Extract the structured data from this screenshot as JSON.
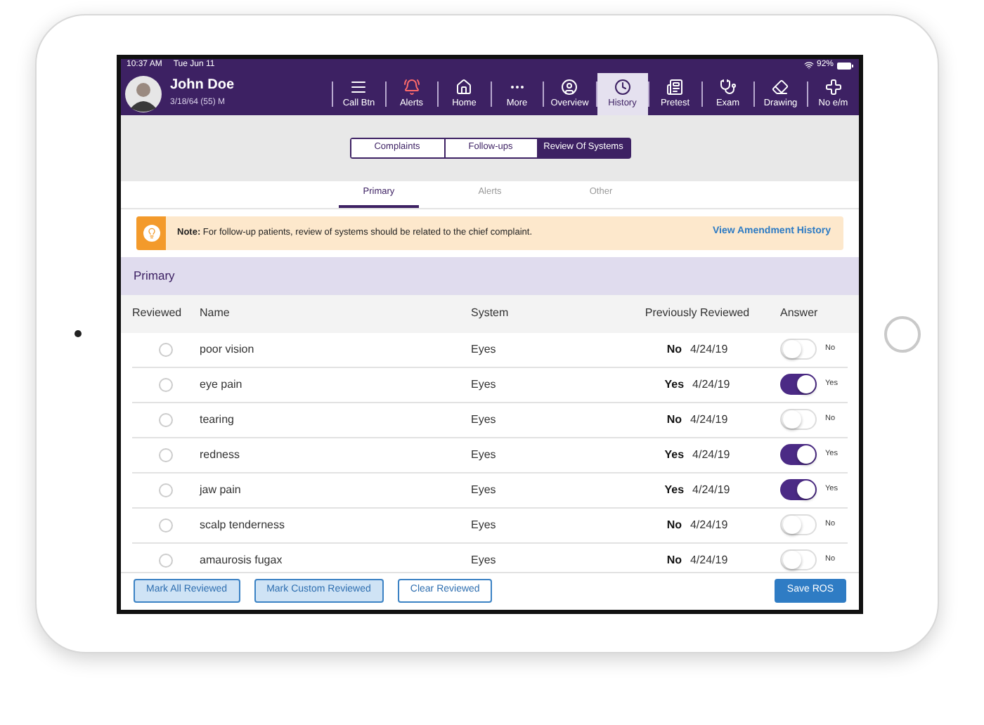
{
  "status_bar": {
    "time": "10:37 AM",
    "date": "Tue Jun 11",
    "battery": "92%"
  },
  "patient": {
    "name": "John Doe",
    "details": "3/18/64 (55) M"
  },
  "nav": [
    {
      "label": "Call Btn",
      "selected": false
    },
    {
      "label": "Alerts",
      "selected": false
    },
    {
      "label": "Home",
      "selected": false
    },
    {
      "label": "More",
      "selected": false
    },
    {
      "label": "Overview",
      "selected": false
    },
    {
      "label": "History",
      "selected": true
    },
    {
      "label": "Pretest",
      "selected": false
    },
    {
      "label": "Exam",
      "selected": false
    },
    {
      "label": "Drawing",
      "selected": false
    },
    {
      "label": "No e/m",
      "selected": false
    }
  ],
  "segments": [
    {
      "label": "Complaints",
      "selected": false
    },
    {
      "label": "Follow-ups",
      "selected": false
    },
    {
      "label": "Review Of Systems",
      "selected": true
    }
  ],
  "tabs": [
    {
      "label": "Primary",
      "selected": true
    },
    {
      "label": "Alerts",
      "selected": false
    },
    {
      "label": "Other",
      "selected": false
    }
  ],
  "note": {
    "text": "**Note:** For follow-up patients, review of systems should be related to the chief complaint.",
    "link": "View Amendment History"
  },
  "section_title": "Primary",
  "table": {
    "columns": [
      "Reviewed",
      "Name",
      "System",
      "Previously Reviewed",
      "Answer"
    ],
    "rows": [
      {
        "reviewed": false,
        "name": "poor vision",
        "system": "Eyes",
        "previous": "No",
        "date": "4/24/19",
        "answer": false,
        "answer_label": "No"
      },
      {
        "reviewed": false,
        "name": "eye pain",
        "system": "Eyes",
        "previous": "Yes",
        "date": "4/24/19",
        "answer": true,
        "answer_label": "Yes"
      },
      {
        "reviewed": false,
        "name": "tearing",
        "system": "Eyes",
        "previous": "No",
        "date": "4/24/19",
        "answer": false,
        "answer_label": "No"
      },
      {
        "reviewed": false,
        "name": "redness",
        "system": "Eyes",
        "previous": "Yes",
        "date": "4/24/19",
        "answer": true,
        "answer_label": "Yes"
      },
      {
        "reviewed": false,
        "name": "jaw pain",
        "system": "Eyes",
        "previous": "Yes",
        "date": "4/24/19",
        "answer": true,
        "answer_label": "Yes"
      },
      {
        "reviewed": false,
        "name": "scalp tenderness",
        "system": "Eyes",
        "previous": "No",
        "date": "4/24/19",
        "answer": false,
        "answer_label": "No"
      },
      {
        "reviewed": false,
        "name": "amaurosis fugax",
        "system": "Eyes",
        "previous": "No",
        "date": "4/24/19",
        "answer": false,
        "answer_label": "No"
      }
    ]
  },
  "buttons": [
    {
      "label": "Mark All Reviewed",
      "kind": "secondary"
    },
    {
      "label": "Mark Custom Reviewed",
      "kind": "secondary"
    },
    {
      "label": "Clear Reviewed",
      "kind": "outline"
    },
    {
      "label": "Save ROS",
      "kind": "primary"
    }
  ]
}
